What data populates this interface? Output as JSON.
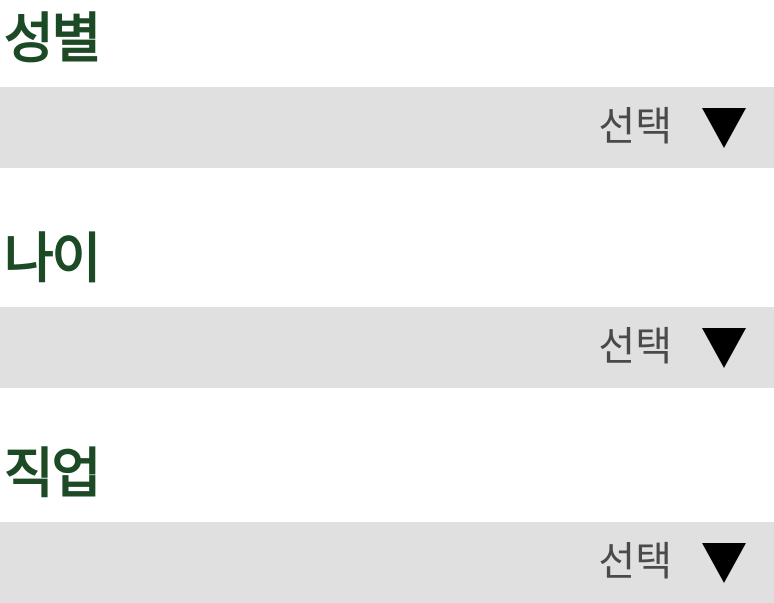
{
  "fields": [
    {
      "label": "성별",
      "value": "선택",
      "icon": "triangle-down-icon"
    },
    {
      "label": "나이",
      "value": "선택",
      "icon": "triangle-down-icon"
    },
    {
      "label": "직업",
      "value": "선택",
      "icon": "triangle-down-icon"
    }
  ],
  "colors": {
    "label": "#1b4a25",
    "select_bg": "#e0e0e0",
    "select_text": "#4a4a4a",
    "icon": "#000000"
  }
}
